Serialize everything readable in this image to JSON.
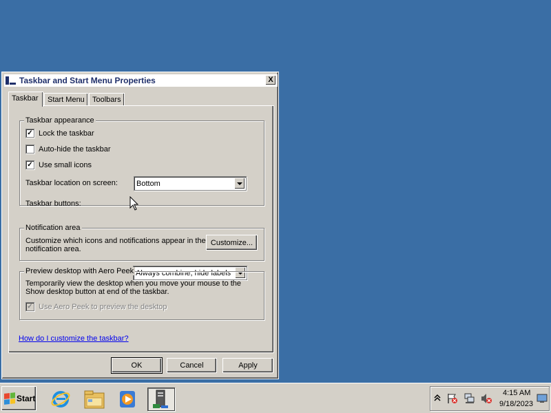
{
  "window": {
    "title": "Taskbar and Start Menu Properties",
    "close_glyph": "X"
  },
  "tabs": [
    {
      "label": "Taskbar",
      "active": true
    },
    {
      "label": "Start Menu",
      "active": false
    },
    {
      "label": "Toolbars",
      "active": false
    }
  ],
  "appearance": {
    "legend": "Taskbar appearance",
    "lock_label": "Lock the taskbar",
    "lock_checked": true,
    "autohide_label": "Auto-hide the taskbar",
    "autohide_checked": false,
    "small_icons_label": "Use small icons",
    "small_icons_checked": true,
    "location_label": "Taskbar location on screen:",
    "location_value": "Bottom",
    "buttons_label": "Taskbar buttons:",
    "buttons_value": "Always combine, hide labels"
  },
  "notification": {
    "legend": "Notification area",
    "text": "Customize which icons and notifications appear in the notification area.",
    "customize_label": "Customize..."
  },
  "aero_peek": {
    "legend": "Preview desktop with Aero Peek",
    "text": "Temporarily view the desktop when you move your mouse to the Show desktop button at end of the taskbar.",
    "checkbox_label": "Use Aero Peek to preview the desktop",
    "checkbox_checked": true,
    "checkbox_disabled": true
  },
  "help_link": "How do I customize the taskbar?",
  "buttons": {
    "ok": "OK",
    "cancel": "Cancel",
    "apply": "Apply"
  },
  "taskbar": {
    "start_label": "Start",
    "pinned": [
      {
        "icon": "internet-explorer-icon"
      },
      {
        "icon": "file-explorer-icon"
      },
      {
        "icon": "media-player-icon"
      },
      {
        "icon": "server-manager-icon",
        "active": true
      }
    ],
    "tray_icons": [
      "show-hidden-icons-chevron",
      "action-center-flag-icon",
      "network-icon",
      "volume-muted-icon"
    ],
    "time": "4:15 AM",
    "date": "9/18/2023",
    "show_desktop_icon": "show-desktop-icon"
  },
  "colors": {
    "desktop": "#3a6ea5",
    "chrome": "#d4d0c8",
    "title_text": "#1f2f6a",
    "link": "#0000ee"
  }
}
